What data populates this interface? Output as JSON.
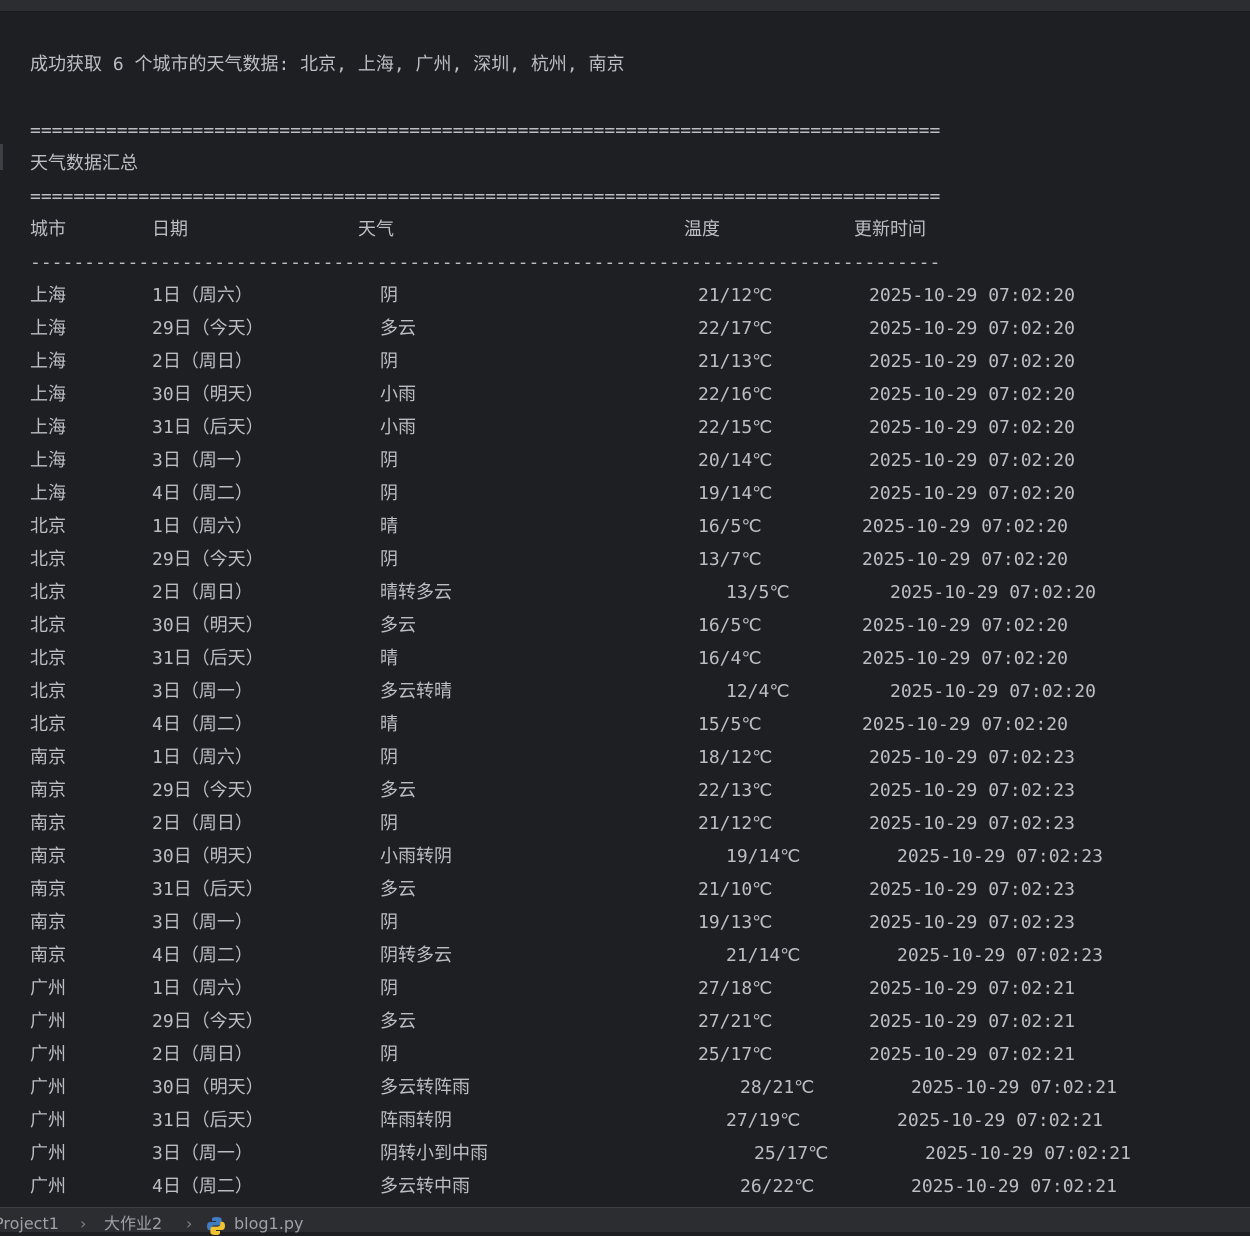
{
  "summary_line": "成功获取 6 个城市的天气数据: 北京, 上海, 广州, 深圳, 杭州, 南京",
  "rule_double": "====================================================================================",
  "section_title": "天气数据汇总",
  "rule_single": "------------------------------------------------------------------------------------",
  "columns": {
    "city": "城市",
    "date": "日期",
    "weather": "天气",
    "temp": "温度",
    "updated": "更新时间"
  },
  "rows": [
    {
      "city": "上海",
      "date": "1日（周六）",
      "weather": "阴",
      "temp": "21/12℃",
      "updated": "2025-10-29 07:02:20"
    },
    {
      "city": "上海",
      "date": "29日（今天）",
      "weather": "多云",
      "temp": "22/17℃",
      "updated": "2025-10-29 07:02:20"
    },
    {
      "city": "上海",
      "date": "2日（周日）",
      "weather": "阴",
      "temp": "21/13℃",
      "updated": "2025-10-29 07:02:20"
    },
    {
      "city": "上海",
      "date": "30日（明天）",
      "weather": "小雨",
      "temp": "22/16℃",
      "updated": "2025-10-29 07:02:20"
    },
    {
      "city": "上海",
      "date": "31日（后天）",
      "weather": "小雨",
      "temp": "22/15℃",
      "updated": "2025-10-29 07:02:20"
    },
    {
      "city": "上海",
      "date": "3日（周一）",
      "weather": "阴",
      "temp": "20/14℃",
      "updated": "2025-10-29 07:02:20"
    },
    {
      "city": "上海",
      "date": "4日（周二）",
      "weather": "阴",
      "temp": "19/14℃",
      "updated": "2025-10-29 07:02:20"
    },
    {
      "city": "北京",
      "date": "1日（周六）",
      "weather": "晴",
      "temp": "16/5℃",
      "updated": "2025-10-29 07:02:20"
    },
    {
      "city": "北京",
      "date": "29日（今天）",
      "weather": "阴",
      "temp": "13/7℃",
      "updated": "2025-10-29 07:02:20"
    },
    {
      "city": "北京",
      "date": "2日（周日）",
      "weather": "晴转多云",
      "temp": "13/5℃",
      "updated": "2025-10-29 07:02:20"
    },
    {
      "city": "北京",
      "date": "30日（明天）",
      "weather": "多云",
      "temp": "16/5℃",
      "updated": "2025-10-29 07:02:20"
    },
    {
      "city": "北京",
      "date": "31日（后天）",
      "weather": "晴",
      "temp": "16/4℃",
      "updated": "2025-10-29 07:02:20"
    },
    {
      "city": "北京",
      "date": "3日（周一）",
      "weather": "多云转晴",
      "temp": "12/4℃",
      "updated": "2025-10-29 07:02:20"
    },
    {
      "city": "北京",
      "date": "4日（周二）",
      "weather": "晴",
      "temp": "15/5℃",
      "updated": "2025-10-29 07:02:20"
    },
    {
      "city": "南京",
      "date": "1日（周六）",
      "weather": "阴",
      "temp": "18/12℃",
      "updated": "2025-10-29 07:02:23"
    },
    {
      "city": "南京",
      "date": "29日（今天）",
      "weather": "多云",
      "temp": "22/13℃",
      "updated": "2025-10-29 07:02:23"
    },
    {
      "city": "南京",
      "date": "2日（周日）",
      "weather": "阴",
      "temp": "21/12℃",
      "updated": "2025-10-29 07:02:23"
    },
    {
      "city": "南京",
      "date": "30日（明天）",
      "weather": "小雨转阴",
      "temp": "19/14℃",
      "updated": "2025-10-29 07:02:23"
    },
    {
      "city": "南京",
      "date": "31日（后天）",
      "weather": "多云",
      "temp": "21/10℃",
      "updated": "2025-10-29 07:02:23"
    },
    {
      "city": "南京",
      "date": "3日（周一）",
      "weather": "阴",
      "temp": "19/13℃",
      "updated": "2025-10-29 07:02:23"
    },
    {
      "city": "南京",
      "date": "4日（周二）",
      "weather": "阴转多云",
      "temp": "21/14℃",
      "updated": "2025-10-29 07:02:23"
    },
    {
      "city": "广州",
      "date": "1日（周六）",
      "weather": "阴",
      "temp": "27/18℃",
      "updated": "2025-10-29 07:02:21"
    },
    {
      "city": "广州",
      "date": "29日（今天）",
      "weather": "多云",
      "temp": "27/21℃",
      "updated": "2025-10-29 07:02:21"
    },
    {
      "city": "广州",
      "date": "2日（周日）",
      "weather": "阴",
      "temp": "25/17℃",
      "updated": "2025-10-29 07:02:21"
    },
    {
      "city": "广州",
      "date": "30日（明天）",
      "weather": "多云转阵雨",
      "temp": "28/21℃",
      "updated": "2025-10-29 07:02:21"
    },
    {
      "city": "广州",
      "date": "31日（后天）",
      "weather": "阵雨转阴",
      "temp": "27/19℃",
      "updated": "2025-10-29 07:02:21"
    },
    {
      "city": "广州",
      "date": "3日（周一）",
      "weather": "阴转小到中雨",
      "temp": "25/17℃",
      "updated": "2025-10-29 07:02:21"
    },
    {
      "city": "广州",
      "date": "4日（周二）",
      "weather": "多云转中雨",
      "temp": "26/22℃",
      "updated": "2025-10-29 07:02:21"
    }
  ],
  "breadcrumb": {
    "project": "Project1",
    "folder": "大作业2",
    "file": "blog1.py",
    "separator": "›"
  }
}
